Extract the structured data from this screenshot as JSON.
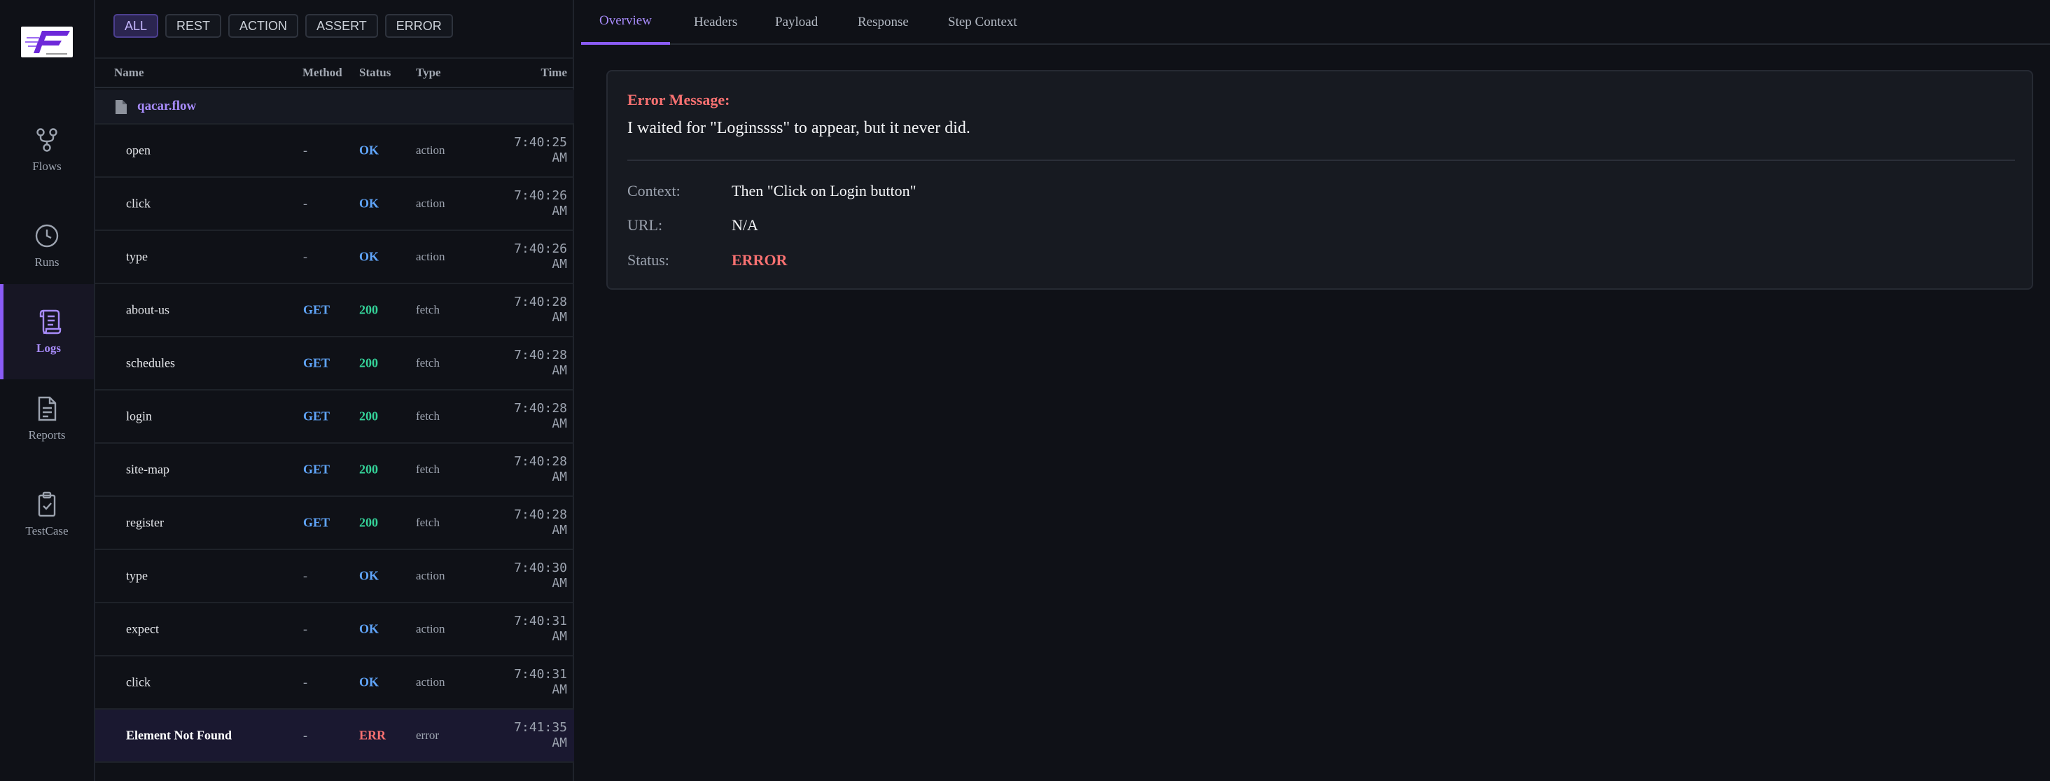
{
  "nav": {
    "items": [
      {
        "label": "Flows",
        "icon": "flows-icon"
      },
      {
        "label": "Runs",
        "icon": "clock-icon"
      },
      {
        "label": "Logs",
        "icon": "scroll-icon",
        "active": true
      },
      {
        "label": "Reports",
        "icon": "document-icon"
      },
      {
        "label": "TestCase",
        "icon": "clipboard-check-icon"
      }
    ]
  },
  "filters": [
    "ALL",
    "REST",
    "ACTION",
    "ASSERT",
    "ERROR"
  ],
  "table": {
    "headers": {
      "name": "Name",
      "method": "Method",
      "status": "Status",
      "type": "Type",
      "time": "Time"
    },
    "group": "qacar.flow",
    "rows": [
      {
        "name": "open",
        "method": "-",
        "status": "OK",
        "type": "action",
        "time1": "7:40:25",
        "time2": "AM"
      },
      {
        "name": "click",
        "method": "-",
        "status": "OK",
        "type": "action",
        "time1": "7:40:26",
        "time2": "AM"
      },
      {
        "name": "type",
        "method": "-",
        "status": "OK",
        "type": "action",
        "time1": "7:40:26",
        "time2": "AM"
      },
      {
        "name": "about-us",
        "method": "GET",
        "status": "200",
        "type": "fetch",
        "time1": "7:40:28",
        "time2": "AM"
      },
      {
        "name": "schedules",
        "method": "GET",
        "status": "200",
        "type": "fetch",
        "time1": "7:40:28",
        "time2": "AM"
      },
      {
        "name": "login",
        "method": "GET",
        "status": "200",
        "type": "fetch",
        "time1": "7:40:28",
        "time2": "AM"
      },
      {
        "name": "site-map",
        "method": "GET",
        "status": "200",
        "type": "fetch",
        "time1": "7:40:28",
        "time2": "AM"
      },
      {
        "name": "register",
        "method": "GET",
        "status": "200",
        "type": "fetch",
        "time1": "7:40:28",
        "time2": "AM"
      },
      {
        "name": "type",
        "method": "-",
        "status": "OK",
        "type": "action",
        "time1": "7:40:30",
        "time2": "AM"
      },
      {
        "name": "expect",
        "method": "-",
        "status": "OK",
        "type": "action",
        "time1": "7:40:31",
        "time2": "AM"
      },
      {
        "name": "click",
        "method": "-",
        "status": "OK",
        "type": "action",
        "time1": "7:40:31",
        "time2": "AM"
      },
      {
        "name": "Element Not Found",
        "method": "-",
        "status": "ERR",
        "type": "error",
        "time1": "7:41:35",
        "time2": "AM",
        "selected": true
      }
    ]
  },
  "detail": {
    "tabs": [
      "Overview",
      "Headers",
      "Payload",
      "Response",
      "Step Context"
    ],
    "error_label": "Error Message:",
    "error_message": "I waited for \"Loginssss\" to appear, but it never did.",
    "context_label": "Context:",
    "context_value": "Then \"Click on Login button\"",
    "url_label": "URL:",
    "url_value": "N/A",
    "status_label": "Status:",
    "status_value": "ERROR"
  },
  "colors": {
    "accent": "#8b5cf6",
    "ok": "#60a5fa",
    "success": "#34d399",
    "error": "#f87171"
  }
}
